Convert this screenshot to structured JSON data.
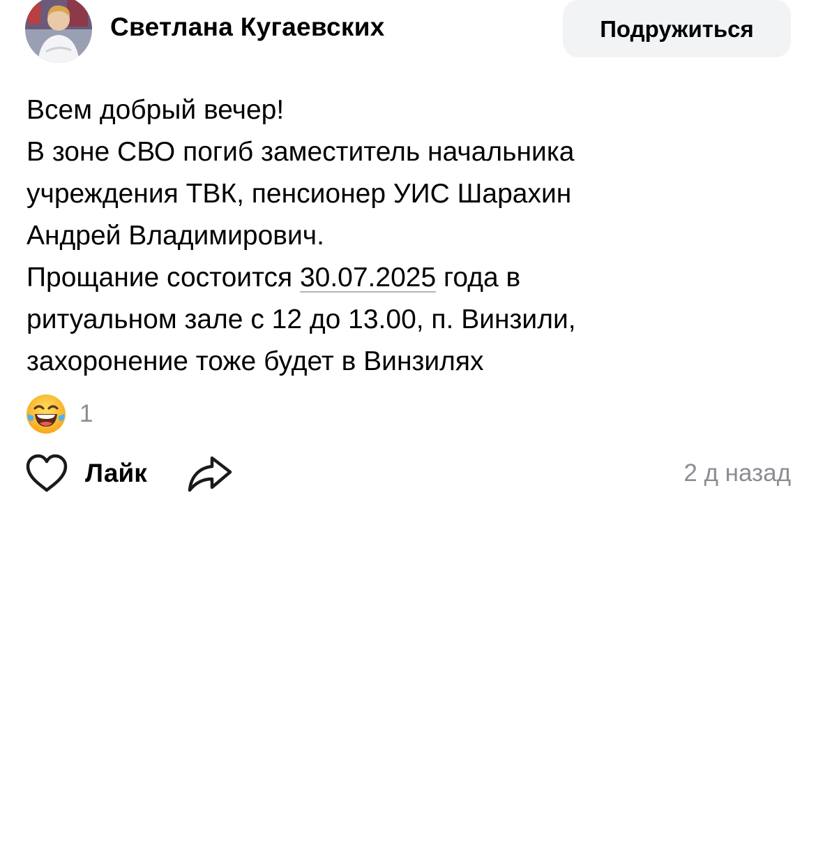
{
  "author": {
    "name": "Светлана Кугаевских",
    "avatar_icon": "user-photo-avatar"
  },
  "friend_button": {
    "label": "Подружиться"
  },
  "post": {
    "line1": "Всем добрый вечер!",
    "line2": "В зоне СВО погиб заместитель начальника",
    "line3": "учреждения ТВК, пенсионер УИС Шарахин",
    "line4": "Андрей Владимирович.",
    "line5_before": "Прощание состоится ",
    "line5_date": "30.07.2025",
    "line5_after": " года в",
    "line6": "ритуальном зале с 12 до 13.00, п. Винзили,",
    "line7": "захоронение тоже будет в Винзилях"
  },
  "reactions": {
    "emoji_icon": "laughing-tears-emoji",
    "count": "1"
  },
  "actions": {
    "like_label": "Лайк",
    "like_icon": "heart-outline-icon",
    "share_icon": "share-arrow-icon",
    "timestamp": "2 д назад"
  },
  "colors": {
    "button_bg": "#f2f3f5",
    "secondary_text": "#8a8d93",
    "primary_text": "#000000"
  }
}
